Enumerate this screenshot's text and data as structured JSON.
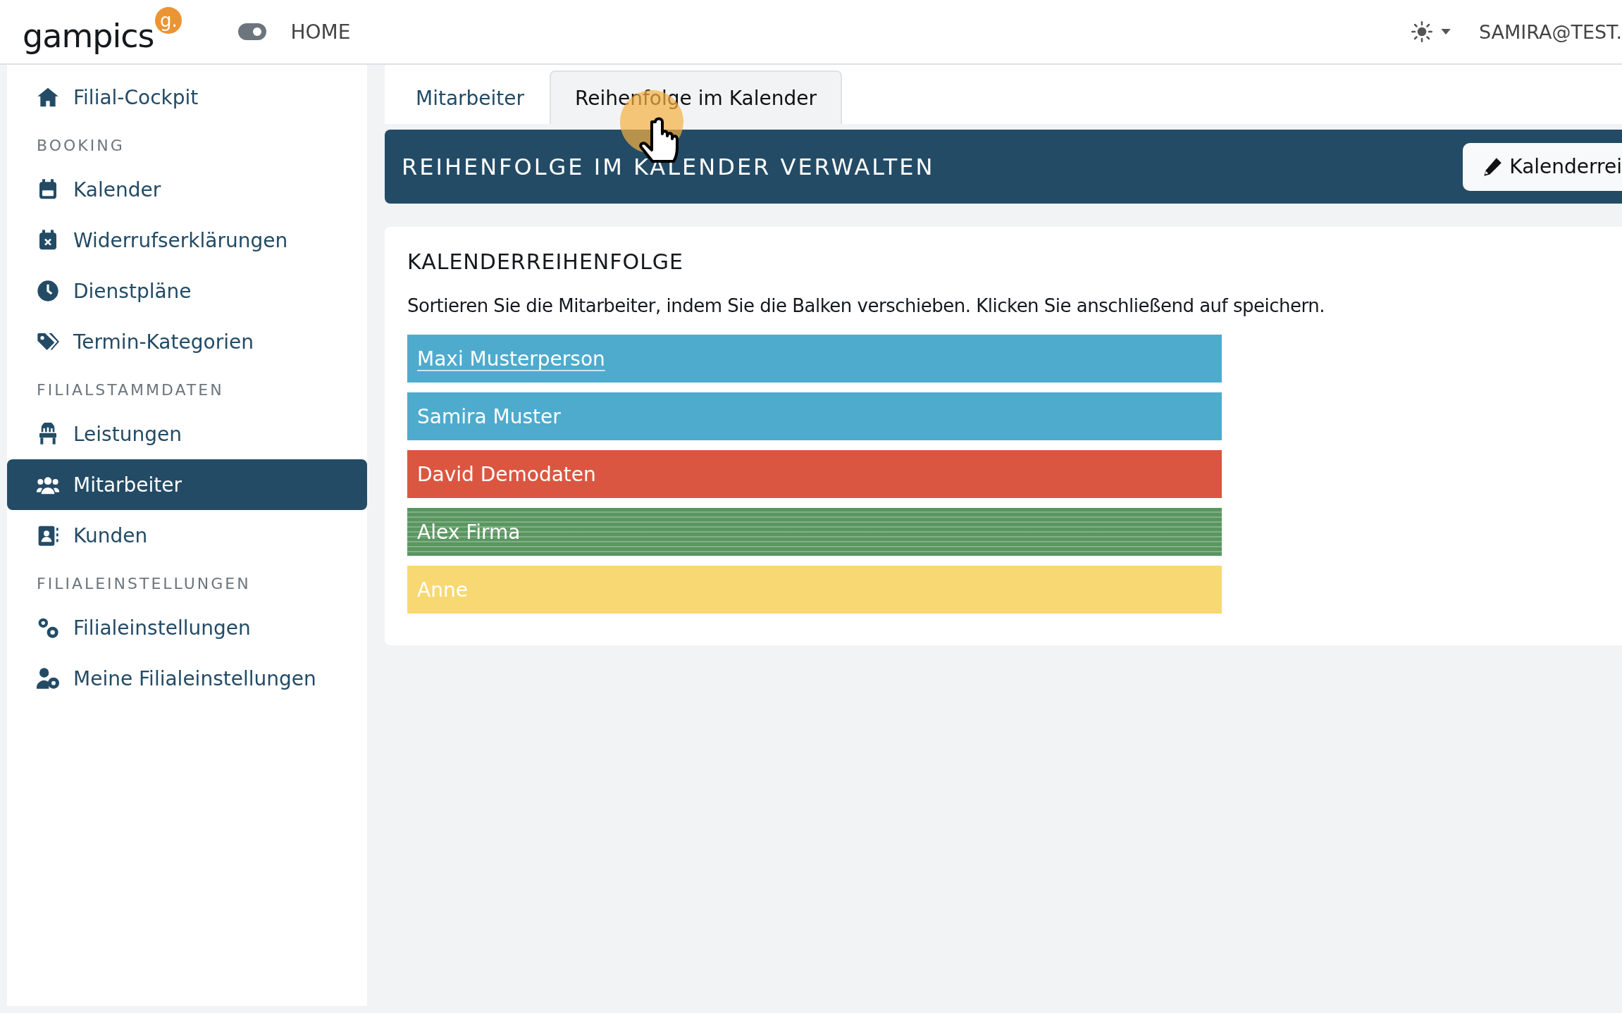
{
  "topbar": {
    "logo": "gampics",
    "logo_badge": "g.",
    "home_link": "HOME",
    "user": "SAMIRA@TEST."
  },
  "sidebar": {
    "items": [
      {
        "kind": "link",
        "label": "Filial-Cockpit",
        "selected": false
      },
      {
        "kind": "section",
        "label": "BOOKING"
      },
      {
        "kind": "link",
        "label": "Kalender",
        "selected": false
      },
      {
        "kind": "link",
        "label": "Widerrufserklärungen",
        "selected": false
      },
      {
        "kind": "link",
        "label": "Dienstpläne",
        "selected": false
      },
      {
        "kind": "link",
        "label": "Termin-Kategorien",
        "selected": false
      },
      {
        "kind": "section",
        "label": "FILIALSTAMMDATEN"
      },
      {
        "kind": "link",
        "label": "Leistungen",
        "selected": false
      },
      {
        "kind": "link",
        "label": "Mitarbeiter",
        "selected": true
      },
      {
        "kind": "link",
        "label": "Kunden",
        "selected": false
      },
      {
        "kind": "section",
        "label": "FILIALEINSTELLUNGEN"
      },
      {
        "kind": "link",
        "label": "Filialeinstellungen",
        "selected": false
      },
      {
        "kind": "link",
        "label": "Meine Filialeinstellungen",
        "selected": false
      }
    ]
  },
  "tabs": [
    {
      "label": "Mitarbeiter",
      "selected": false
    },
    {
      "label": "Reihenfolge im Kalender",
      "selected": true
    }
  ],
  "header": {
    "title": "REIHENFOLGE IM KALENDER VERWALTEN",
    "button": "Kalenderrei"
  },
  "card": {
    "title": "KALENDERREIHENFOLGE",
    "text": "Sortieren Sie die Mitarbeiter, indem Sie die Balken verschieben. Klicken Sie anschließend auf speichern.",
    "bars": [
      {
        "name": "Maxi Musterperson",
        "color": "#4eabcd",
        "striped": false,
        "hovered": true
      },
      {
        "name": "Samira Muster",
        "color": "#4eabcd",
        "striped": false,
        "hovered": false
      },
      {
        "name": "David Demodaten",
        "color": "#db5641",
        "striped": false,
        "hovered": false
      },
      {
        "name": "Alex Firma",
        "color": "#5a9660",
        "striped": true,
        "hovered": false
      },
      {
        "name": "Anne",
        "color": "#f8d872",
        "striped": false,
        "hovered": false
      }
    ]
  }
}
